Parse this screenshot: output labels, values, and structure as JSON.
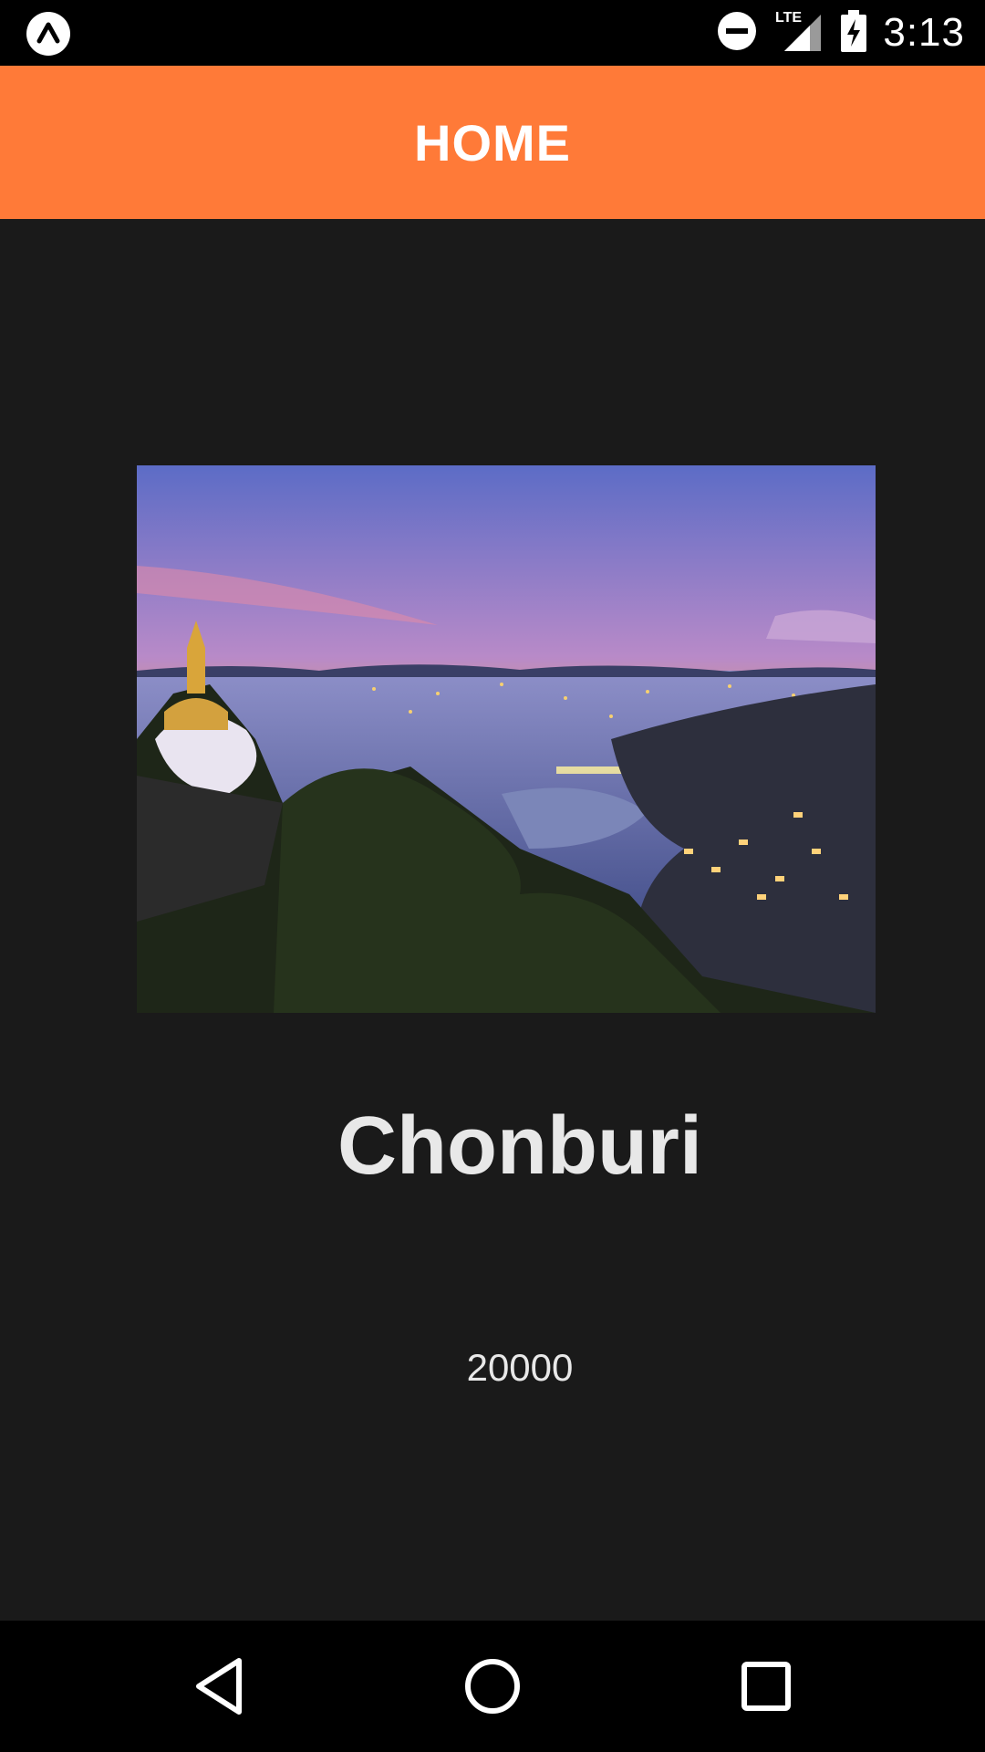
{
  "status_bar": {
    "time": "3:13",
    "network": "LTE",
    "icons": [
      "app-launcher-icon",
      "do-not-disturb-icon",
      "signal-icon",
      "battery-charging-icon"
    ]
  },
  "app_bar": {
    "title": "HOME",
    "color": "#ff7a38"
  },
  "detail": {
    "image_icon": "landscape-photo",
    "city": "Chonburi",
    "postal_code": "20000"
  },
  "nav_bar": {
    "icons": [
      "back-icon",
      "home-icon",
      "recents-icon"
    ]
  }
}
